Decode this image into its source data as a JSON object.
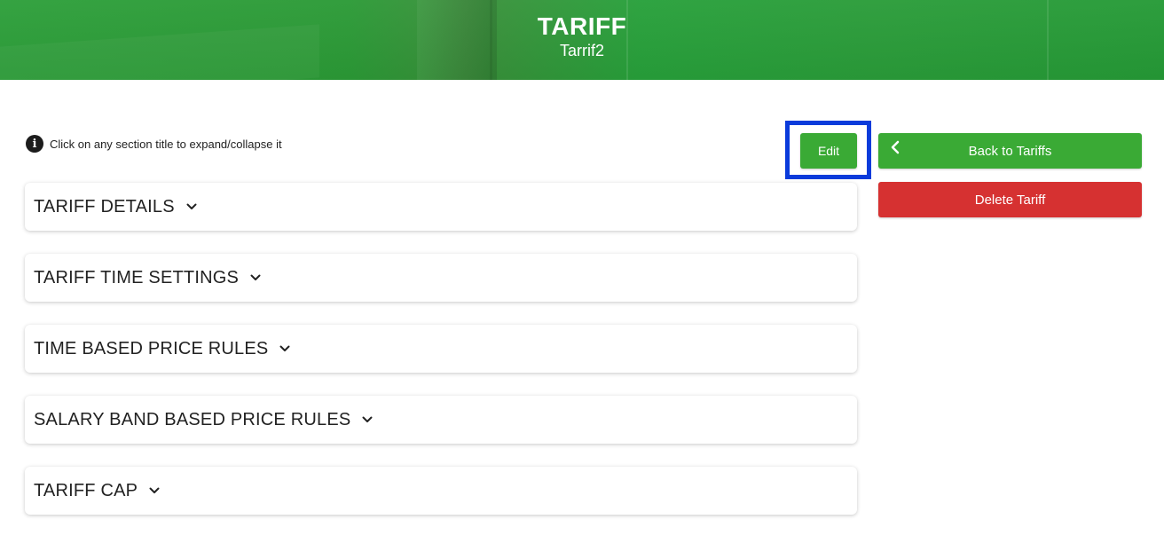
{
  "banner": {
    "title": "TARIFF",
    "subtitle": "Tarrif2"
  },
  "hint": {
    "icon": "info-icon",
    "text": "Click on any section title to expand/collapse it"
  },
  "actions": {
    "edit_label": "Edit",
    "back_label": "Back to Tariffs",
    "delete_label": "Delete Tariff"
  },
  "colors": {
    "primary": "#3aaa35",
    "danger": "#d63131",
    "highlight": "#0a3bdb"
  },
  "sections": [
    {
      "label": "TARIFF DETAILS"
    },
    {
      "label": "TARIFF TIME SETTINGS"
    },
    {
      "label": "TIME BASED PRICE RULES"
    },
    {
      "label": "SALARY BAND BASED PRICE RULES"
    },
    {
      "label": "TARIFF CAP"
    }
  ]
}
